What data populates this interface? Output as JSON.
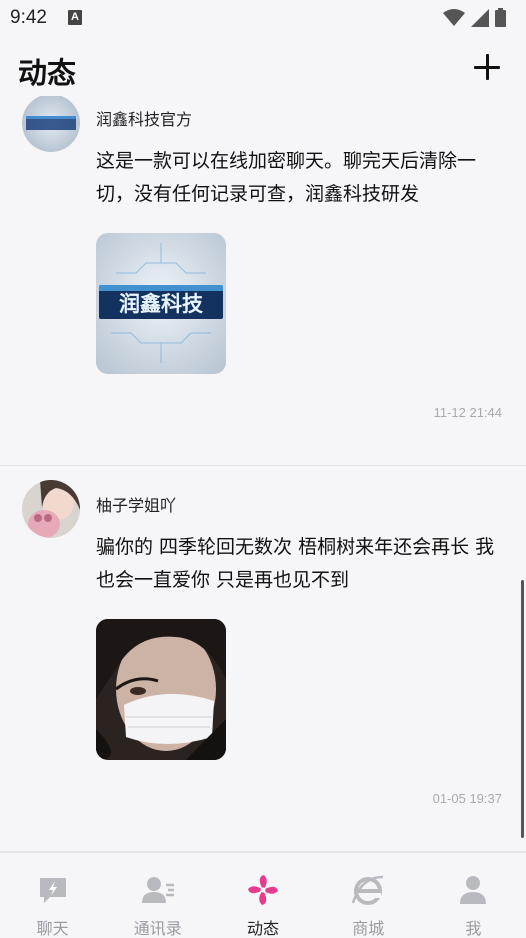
{
  "status_bar": {
    "time": "9:42",
    "indicator": "A"
  },
  "header": {
    "title": "动态"
  },
  "posts": [
    {
      "author": "润鑫科技官方",
      "text": "这是一款可以在线加密聊天。聊完天后清除一切，没有任何记录可查，润鑫科技研发",
      "image_text": "润鑫科技",
      "timestamp": "11-12 21:44"
    },
    {
      "author": "柚子学姐吖",
      "text": "骗你的 四季轮回无数次 梧桐树来年还会再长 我也会一直爱你 只是再也见不到",
      "timestamp": "01-05 19:37"
    }
  ],
  "tabs": [
    {
      "label": "聊天",
      "icon": "chat-bubble-icon"
    },
    {
      "label": "通讯录",
      "icon": "contacts-icon"
    },
    {
      "label": "动态",
      "icon": "pinwheel-icon"
    },
    {
      "label": "商城",
      "icon": "store-e-icon"
    },
    {
      "label": "我",
      "icon": "person-icon"
    }
  ],
  "colors": {
    "accent": "#e63b8f",
    "inactive": "#9a9aa3",
    "background": "#f6f6f9"
  }
}
